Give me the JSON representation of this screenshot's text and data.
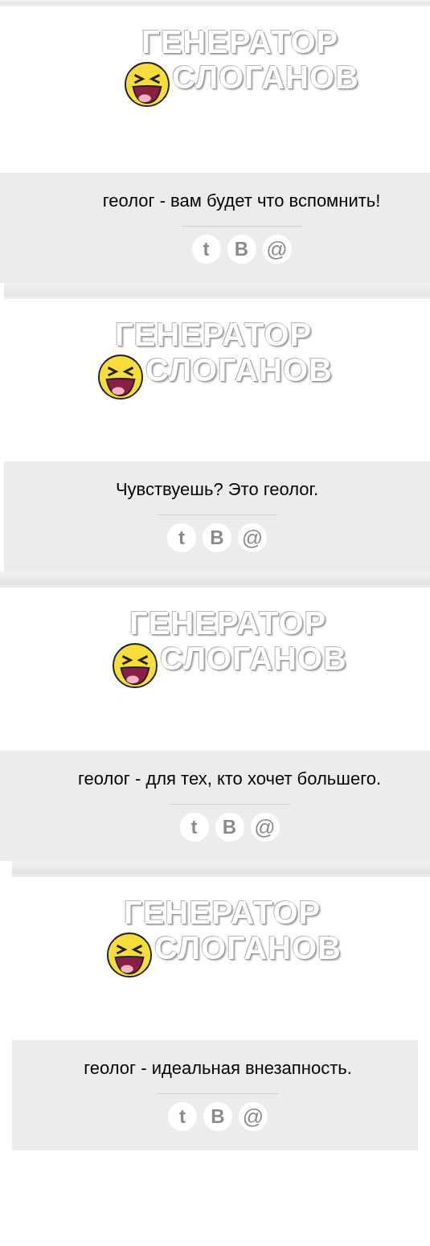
{
  "panels": [
    {
      "logo": {
        "line_1": "ГЕНЕРАТОР",
        "line_2": "СЛОГАНОВ"
      },
      "slogan": "геолог - вам будет что вспомнить!",
      "share": [
        {
          "kind": "twitter",
          "label": "t"
        },
        {
          "kind": "vk",
          "label": "В"
        },
        {
          "kind": "mail",
          "label": "@"
        }
      ]
    },
    {
      "logo": {
        "line_1": "ГЕНЕРАТОР",
        "line_2": "СЛОГАНОВ"
      },
      "slogan": "Чувствуешь? Это геолог.",
      "share": [
        {
          "kind": "twitter",
          "label": "t"
        },
        {
          "kind": "vk",
          "label": "В"
        },
        {
          "kind": "mail",
          "label": "@"
        }
      ]
    },
    {
      "logo": {
        "line_1": "ГЕНЕРАТОР",
        "line_2": "СЛОГАНОВ"
      },
      "slogan": "геолог - для тех, кто хочет большего.",
      "share": [
        {
          "kind": "twitter",
          "label": "t"
        },
        {
          "kind": "vk",
          "label": "В"
        },
        {
          "kind": "mail",
          "label": "@"
        }
      ]
    },
    {
      "logo": {
        "line_1": "ГЕНЕРАТОР",
        "line_2": "СЛОГАНОВ"
      },
      "slogan": "геолог - идеальная внезапность.",
      "share": [
        {
          "kind": "twitter",
          "label": "t"
        },
        {
          "kind": "vk",
          "label": "В"
        },
        {
          "kind": "mail",
          "label": "@"
        }
      ]
    }
  ]
}
